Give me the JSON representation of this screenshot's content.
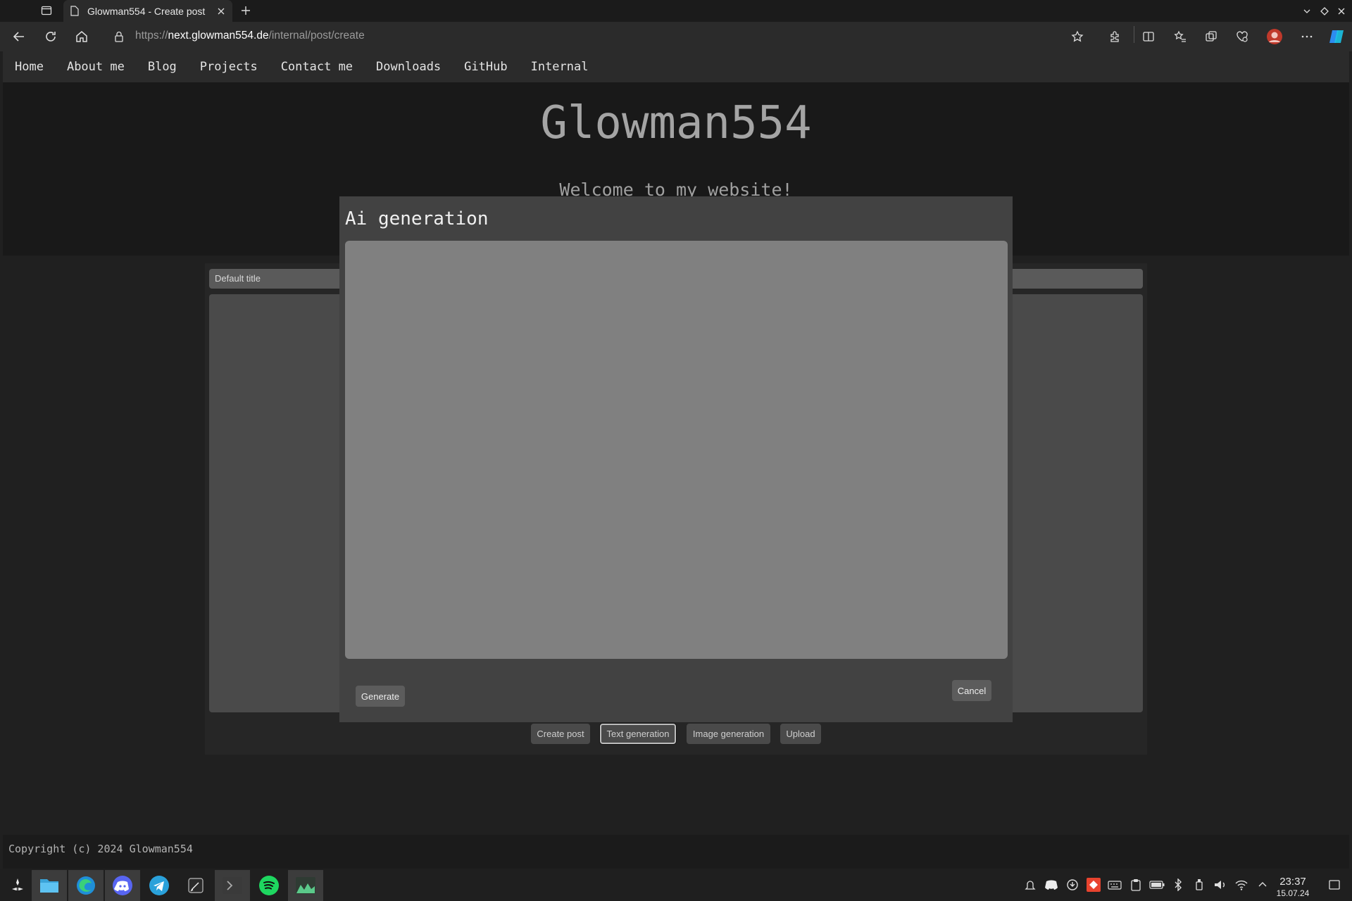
{
  "browser": {
    "tab_title": "Glowman554 - Create post",
    "url_prefix": "https://",
    "url_host": "next.glowman554.de",
    "url_path": "/internal/post/create"
  },
  "nav": {
    "items": [
      "Home",
      "About me",
      "Blog",
      "Projects",
      "Contact me",
      "Downloads",
      "GitHub",
      "Internal"
    ]
  },
  "hero": {
    "title": "Glowman554",
    "subtitle": "Welcome to my website!"
  },
  "form": {
    "title_value": "Default title",
    "buttons": {
      "create": "Create post",
      "text_generation": "Text generation",
      "image_generation": "Image generation",
      "upload": "Upload"
    }
  },
  "modal": {
    "title": "Ai generation",
    "generate_label": "Generate",
    "cancel_label": "Cancel"
  },
  "footer": {
    "copyright": "Copyright (c) 2024 Glowman554"
  },
  "taskbar": {
    "apps": [
      "launcher-icon",
      "file-manager-icon",
      "edge-icon",
      "discord-icon",
      "telegram-icon",
      "notes-icon",
      "terminal-icon",
      "spotify-icon",
      "system-monitor-icon"
    ],
    "time": "23:37",
    "date": "15.07.24"
  },
  "colors": {
    "page_bg": "#202020",
    "hero_bg": "#191919",
    "modal_bg": "#424242",
    "modal_textarea": "#808080",
    "spotify": "#1ed760",
    "telegram": "#2aa1da",
    "discord": "#5865f2"
  }
}
